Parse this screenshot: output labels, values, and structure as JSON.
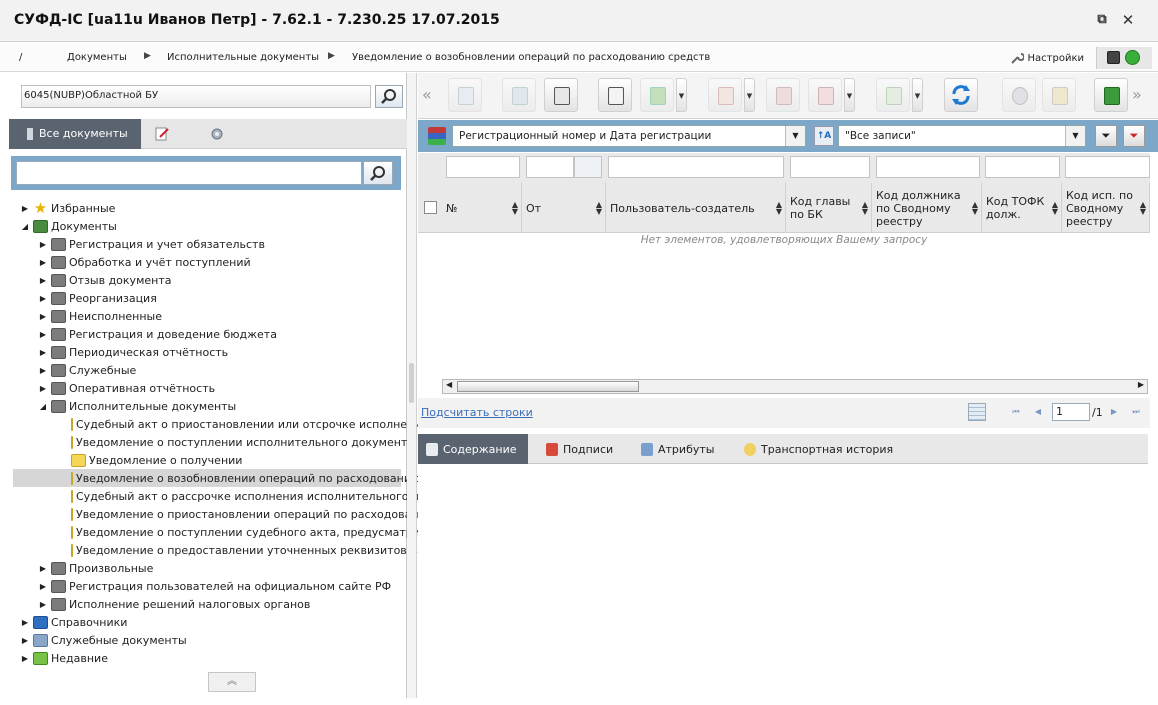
{
  "window": {
    "title": "СУФД-IC [ua11u Иванов Петр] - 7.62.1 - 7.230.25 17.07.2015",
    "restore_icon": "⧉",
    "close_icon": "✕"
  },
  "breadcrumb": [
    "/",
    "Документы",
    "Исполнительные документы",
    "Уведомление о возобновлении операций по расходованию средств"
  ],
  "settings_label": "Настройки",
  "org_field": {
    "value": "6045(NUBP)Областной БУ"
  },
  "left_tabs": {
    "all_docs": "Все документы"
  },
  "tree": [
    {
      "label": "Избранные",
      "expanded": false,
      "level": 0,
      "icon": "star-icon"
    },
    {
      "label": "Документы",
      "expanded": true,
      "level": 0,
      "icon": "documents-icon"
    },
    {
      "label": "Регистрация и учет обязательств",
      "expanded": false,
      "level": 1,
      "icon": "folder-icon"
    },
    {
      "label": "Обработка и учёт поступлений",
      "expanded": false,
      "level": 1,
      "icon": "folder-icon"
    },
    {
      "label": "Отзыв документа",
      "expanded": false,
      "level": 1,
      "icon": "folder-icon"
    },
    {
      "label": "Реорганизация",
      "expanded": false,
      "level": 1,
      "icon": "folder-icon"
    },
    {
      "label": "Неисполненные",
      "expanded": false,
      "level": 1,
      "icon": "folder-icon"
    },
    {
      "label": "Регистрация и доведение бюджета",
      "expanded": false,
      "level": 1,
      "icon": "folder-icon"
    },
    {
      "label": "Периодическая отчётность",
      "expanded": false,
      "level": 1,
      "icon": "folder-icon"
    },
    {
      "label": "Служебные",
      "expanded": false,
      "level": 1,
      "icon": "folder-icon"
    },
    {
      "label": "Оперативная отчётность",
      "expanded": false,
      "level": 1,
      "icon": "folder-icon"
    },
    {
      "label": "Исполнительные документы",
      "expanded": true,
      "level": 1,
      "icon": "folder-icon"
    },
    {
      "label": "Судебный акт о приостановлении или отсрочке исполнения",
      "level": 2,
      "icon": "folder-open-icon"
    },
    {
      "label": "Уведомление о поступлении исполнительного документа",
      "level": 2,
      "icon": "folder-open-icon"
    },
    {
      "label": "Уведомление о получении",
      "level": 2,
      "icon": "folder-open-icon"
    },
    {
      "label": "Уведомление о возобновлении операций по расходованию",
      "level": 2,
      "icon": "folder-open-icon",
      "selected": true
    },
    {
      "label": "Судебный акт о рассрочке исполнения исполнительного док",
      "level": 2,
      "icon": "folder-open-icon"
    },
    {
      "label": "Уведомление о приостановлении операций по расходовани",
      "level": 2,
      "icon": "folder-open-icon"
    },
    {
      "label": "Уведомление о поступлении судебного акта, предусматрив",
      "level": 2,
      "icon": "folder-open-icon"
    },
    {
      "label": "Уведомление о предоставлении уточненных реквизитов ба",
      "level": 2,
      "icon": "folder-open-icon"
    },
    {
      "label": "Произвольные",
      "expanded": false,
      "level": 1,
      "icon": "folder-icon"
    },
    {
      "label": "Регистрация пользователей на официальном сайте РФ",
      "expanded": false,
      "level": 1,
      "icon": "folder-icon"
    },
    {
      "label": "Исполнение решений налоговых органов",
      "expanded": false,
      "level": 1,
      "icon": "folder-icon"
    },
    {
      "label": "Справочники",
      "expanded": false,
      "level": 0,
      "icon": "book-icon"
    },
    {
      "label": "Служебные документы",
      "expanded": false,
      "level": 0,
      "icon": "service-docs-icon"
    },
    {
      "label": "Недавние",
      "expanded": false,
      "level": 0,
      "icon": "recent-icon"
    }
  ],
  "filter": {
    "sort_field": "Регистрационный номер и Дата регистрации",
    "records": "\"Все записи\""
  },
  "grid": {
    "columns": [
      "№",
      "От",
      "Пользователь-создатель",
      "Код главы по БК",
      "Код должника по Сводному реестру",
      "Код ТОФК долж.",
      "Код исп. по Сводному реестру"
    ],
    "empty_message": "Нет элементов, удовлетворяющих Вашему запросу"
  },
  "pager": {
    "count_link": "Подсчитать строки",
    "page": "1",
    "total": "/1"
  },
  "bottom_tabs": [
    "Содержание",
    "Подписи",
    "Атрибуты",
    "Транспортная история"
  ],
  "colors": {
    "accent_blue": "#7da7c9",
    "active_tab": "#5a6470"
  }
}
